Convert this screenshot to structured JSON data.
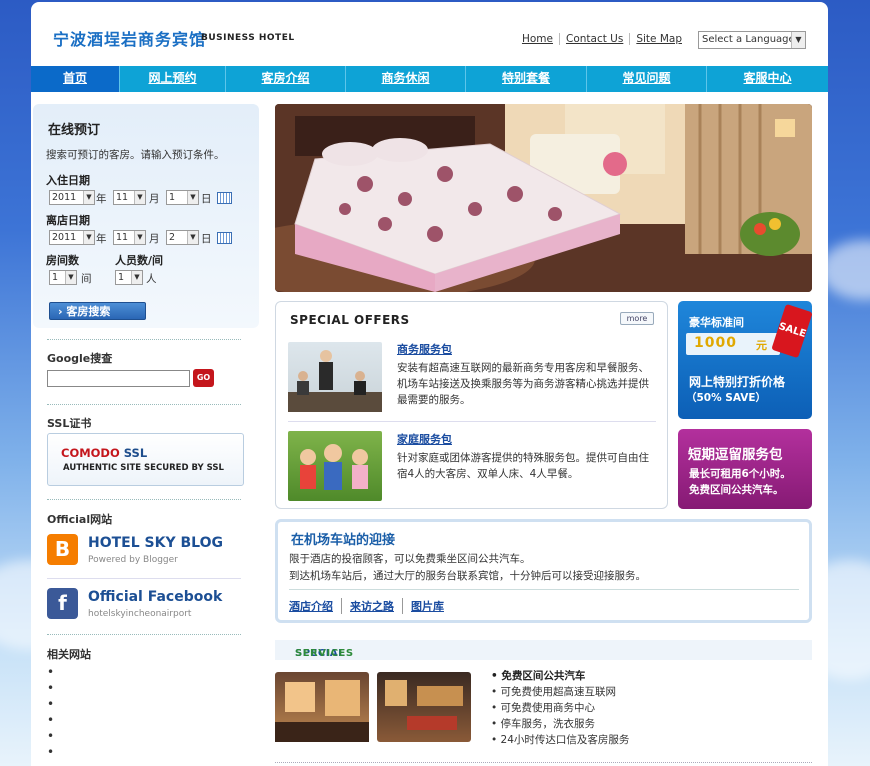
{
  "header": {
    "logo": "宁波酒埕岩商务宾馆",
    "logo_sub": "BUSINESS HOTEL",
    "links": [
      "Home",
      "Contact Us",
      "Site Map"
    ],
    "language": "Select a Language"
  },
  "nav": [
    "首页",
    "网上预约",
    "客房介绍",
    "商务休闲",
    "特别套餐",
    "常见问题",
    "客服中心"
  ],
  "booking": {
    "title": "在线预订",
    "desc": "搜索可预订的客房。请输入预订条件。",
    "checkin_label": "入住日期",
    "checkout_label": "离店日期",
    "checkin": {
      "year": "2011",
      "month": "11",
      "day": "1"
    },
    "checkout": {
      "year": "2011",
      "month": "11",
      "day": "2"
    },
    "unit_year": "年",
    "unit_month": "月",
    "unit_day": "日",
    "rooms_label": "房间数",
    "people_label": "人员数/间",
    "rooms": "1",
    "people": "1",
    "unit_room": "间",
    "unit_person": "人",
    "search_button": "客房搜索"
  },
  "google": {
    "title": "Google搜查",
    "button": "GO",
    "value": ""
  },
  "ssl": {
    "title": "SSL证书",
    "brand_a": "COMODO",
    "brand_b": " SSL",
    "sub": "AUTHENTIC SITE SECURED BY SSL"
  },
  "official": {
    "title": "Official网站",
    "blog": {
      "title": "HOTEL SKY BLOG",
      "sub": "Powered by Blogger",
      "icon": "B"
    },
    "facebook": {
      "title": "Official Facebook",
      "sub": "hotelskyincheonairport",
      "icon": "f"
    }
  },
  "related": {
    "title": "相关网站",
    "bullets": [
      "•",
      "•",
      "•",
      "•",
      "•",
      "•"
    ]
  },
  "offers": {
    "title": "SPECIAL OFFERS",
    "more": "more",
    "items": [
      {
        "title": "商务服务包",
        "text": "安装有超高速互联网的最新商务专用客房和早餐服务、机场车站接送及换乘服务等为商务游客精心挑选并提供最需要的服务。"
      },
      {
        "title": "家庭服务包",
        "text": "针对家庭或团体游客提供的特殊服务包。提供可自由住宿4人的大客房、双单人床、4人早餐。"
      }
    ]
  },
  "promo1": {
    "line1": "豪华标准间",
    "price": "1000",
    "unit": "元",
    "tag": "SALE",
    "line2": "网上特别打折价格",
    "line3": "（50% SAVE）"
  },
  "promo2": {
    "title": "短期逗留服务包",
    "line1": "最长可租用6个小时。",
    "line2": "免费区间公共汽车。"
  },
  "airport": {
    "title": "在机场车站的迎接",
    "line1": "限于酒店的投宿顾客，可以免费乘坐区间公共汽车。",
    "line2": "到达机场车站后，通过大厅的服务台联系宾馆，十分钟后可以接受迎接服务。",
    "links": [
      "酒店介绍",
      "来访之路",
      "图片库"
    ]
  },
  "services": {
    "title_a": "SPECIAL ",
    "title_b": "SERVICES",
    "items": [
      "• 免费区间公共汽车",
      "• 可免费使用超高速互联网",
      "• 可免费使用商务中心",
      "• 停车服务，洗衣服务",
      "• 24小时传达口信及客房服务"
    ]
  },
  "colors": {
    "nav": "#0ea3d6",
    "nav_active": "#0b6ac9",
    "link": "#1a4ca0",
    "promo_blue": "#1f86da",
    "promo_purple": "#b3309d",
    "services_green": "#2e8b3a"
  }
}
